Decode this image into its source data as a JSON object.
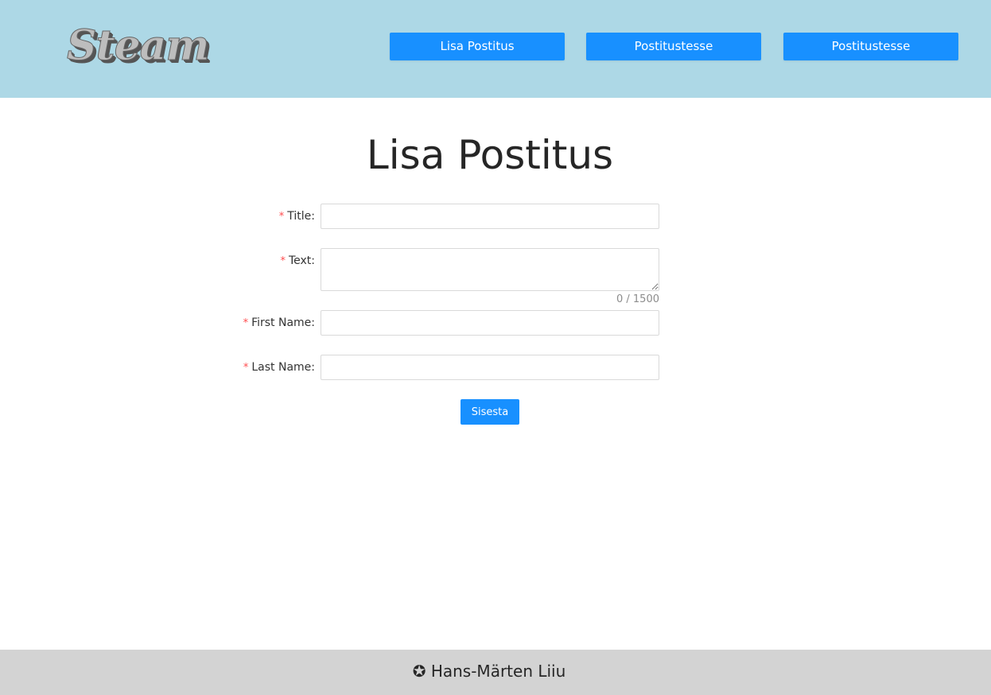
{
  "header": {
    "logo_text": "Steam",
    "nav": [
      {
        "label": "Lisa Postitus"
      },
      {
        "label": "Postitustesse"
      },
      {
        "label": "Postitustesse"
      }
    ],
    "background_color": "#add8e6",
    "button_color": "#1890ff"
  },
  "main": {
    "title": "Lisa Postitus",
    "form": {
      "required_marker": "*",
      "fields": [
        {
          "label": "Title:",
          "value": "",
          "placeholder": ""
        },
        {
          "label": "Text:",
          "value": "",
          "placeholder": "",
          "counter": "0 / 1500"
        },
        {
          "label": "First Name:",
          "value": "",
          "placeholder": ""
        },
        {
          "label": "Last Name:",
          "value": "",
          "placeholder": ""
        }
      ],
      "submit_label": "Sisesta"
    }
  },
  "footer": {
    "icon": "star-circle-icon",
    "icon_glyph": "✪",
    "text": "Hans-Märten Liiu",
    "background_color": "#d3d3d3"
  }
}
